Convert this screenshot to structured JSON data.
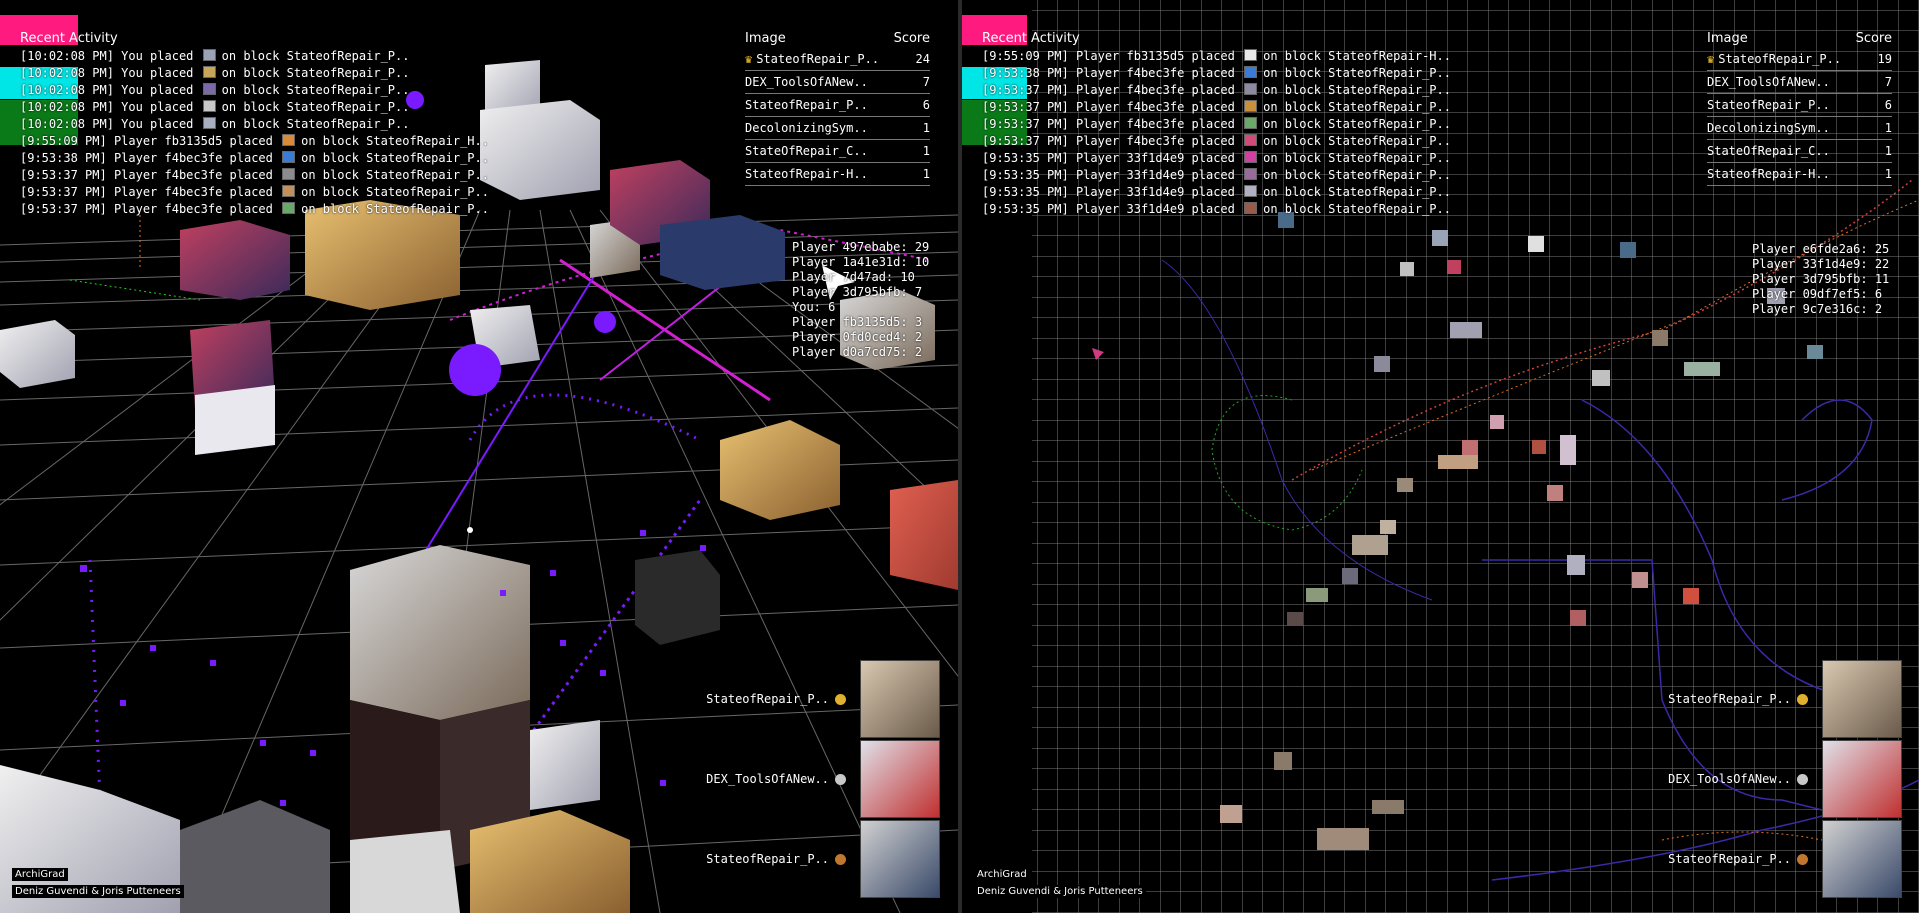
{
  "left": {
    "activity_title": "Recent Activity",
    "activity": [
      {
        "time": "[10:02:08 PM]",
        "text": "You placed",
        "block": "on block StateofRepair_P..",
        "color": "#9aa3b5"
      },
      {
        "time": "[10:02:08 PM]",
        "text": "You placed",
        "block": "on block StateofRepair_P..",
        "color": "#c7a65b"
      },
      {
        "time": "[10:02:08 PM]",
        "text": "You placed",
        "block": "on block StateofRepair_P..",
        "color": "#7a6aa8"
      },
      {
        "time": "[10:02:08 PM]",
        "text": "You placed",
        "block": "on block StateofRepair_P..",
        "color": "#c9c9c9"
      },
      {
        "time": "[10:02:08 PM]",
        "text": "You placed",
        "block": "on block StateofRepair_P..",
        "color": "#a8b0c0"
      },
      {
        "time": "[9:55:09 PM]",
        "text": "Player fb3135d5 placed",
        "block": "on block StateofRepair_H..",
        "color": "#d88a3a"
      },
      {
        "time": "[9:53:38 PM]",
        "text": "Player f4bec3fe placed",
        "block": "on block StateofRepair_P..",
        "color": "#3a7bd5"
      },
      {
        "time": "[9:53:37 PM]",
        "text": "Player f4bec3fe placed",
        "block": "on block StateofRepair_P..",
        "color": "#8c8c8c"
      },
      {
        "time": "[9:53:37 PM]",
        "text": "Player f4bec3fe placed",
        "block": "on block StateofRepair_P..",
        "color": "#c2905a"
      },
      {
        "time": "[9:53:37 PM]",
        "text": "Player f4bec3fe placed",
        "block": "on block StateofRepair_P..",
        "color": "#6aa86a"
      }
    ],
    "board_head": {
      "image": "Image",
      "score": "Score"
    },
    "board": [
      {
        "name": "StateofRepair_P..",
        "score": "24",
        "crown": "♛"
      },
      {
        "name": "DEX_ToolsOfANew..",
        "score": "7",
        "crown": ""
      },
      {
        "name": "StateofRepair_P..",
        "score": "6",
        "crown": ""
      },
      {
        "name": "DecolonizingSym..",
        "score": "1",
        "crown": ""
      },
      {
        "name": "StateOfRepair_C..",
        "score": "1",
        "crown": ""
      },
      {
        "name": "StateofRepair-H..",
        "score": "1",
        "crown": ""
      }
    ],
    "players": [
      "Player 497ebabe: 29",
      "Player 1a41e31d: 10",
      "Player 7d47ad: 10",
      "Player 3d795bfb: 7",
      "You: 6",
      "Player fb3135d5: 3",
      "Player 0fd0ced4: 2",
      "Player d0a7cd75: 2"
    ],
    "gallery": [
      {
        "label": "StateofRepair_P..",
        "medal": "#e0b030"
      },
      {
        "label": "DEX_ToolsOfANew..",
        "medal": "#c8c8c8"
      },
      {
        "label": "StateofRepair_P..",
        "medal": "#c07830"
      }
    ],
    "credit_1": "ArchiGrad",
    "credit_2": "Deniz Guvendi & Joris Putteneers"
  },
  "right": {
    "activity_title": "Recent Activity",
    "activity": [
      {
        "time": "[9:55:09 PM]",
        "text": "Player fb3135d5 placed",
        "block": "on block StateofRepair-H..",
        "color": "#e8e8e8"
      },
      {
        "time": "[9:53:38 PM]",
        "text": "Player f4bec3fe placed",
        "block": "on block StateofRepair_P..",
        "color": "#3a7bd5"
      },
      {
        "time": "[9:53:37 PM]",
        "text": "Player f4bec3fe placed",
        "block": "on block StateofRepair_P..",
        "color": "#8a8aa0"
      },
      {
        "time": "[9:53:37 PM]",
        "text": "Player f4bec3fe placed",
        "block": "on block StateofRepair_P..",
        "color": "#c8903a"
      },
      {
        "time": "[9:53:37 PM]",
        "text": "Player f4bec3fe placed",
        "block": "on block StateofRepair_P..",
        "color": "#6aa86a"
      },
      {
        "time": "[9:53:37 PM]",
        "text": "Player f4bec3fe placed",
        "block": "on block StateofRepair_P..",
        "color": "#d04a7a"
      },
      {
        "time": "[9:53:35 PM]",
        "text": "Player 33f1d4e9 placed",
        "block": "on block StateofRepair_P..",
        "color": "#d040a0"
      },
      {
        "time": "[9:53:35 PM]",
        "text": "Player 33f1d4e9 placed",
        "block": "on block StateofRepair_P..",
        "color": "#9a6a9a"
      },
      {
        "time": "[9:53:35 PM]",
        "text": "Player 33f1d4e9 placed",
        "block": "on block StateofRepair_P..",
        "color": "#b0b0c0"
      },
      {
        "time": "[9:53:35 PM]",
        "text": "Player 33f1d4e9 placed",
        "block": "on block StateofRepair_P..",
        "color": "#9a5a4a"
      }
    ],
    "board_head": {
      "image": "Image",
      "score": "Score"
    },
    "board": [
      {
        "name": "StateofRepair_P..",
        "score": "19",
        "crown": "♛"
      },
      {
        "name": "DEX_ToolsOfANew..",
        "score": "7",
        "crown": ""
      },
      {
        "name": "StateofRepair_P..",
        "score": "6",
        "crown": ""
      },
      {
        "name": "DecolonizingSym..",
        "score": "1",
        "crown": ""
      },
      {
        "name": "StateOfRepair_C..",
        "score": "1",
        "crown": ""
      },
      {
        "name": "StateofRepair-H..",
        "score": "1",
        "crown": ""
      }
    ],
    "players": [
      "Player e6fde2a6: 25",
      "Player 33f1d4e9: 22",
      "Player 3d795bfb: 11",
      "Player 09df7ef5: 6",
      "Player 9c7e316c: 2"
    ],
    "gallery": [
      {
        "label": "StateofRepair_P..",
        "medal": "#e0b030"
      },
      {
        "label": "DEX_ToolsOfANew..",
        "medal": "#c8c8c8"
      },
      {
        "label": "StateofRepair_P..",
        "medal": "#c07830"
      }
    ],
    "credit_1": "ArchiGrad",
    "credit_2": "Deniz Guvendi & Joris Putteneers"
  },
  "colors": {
    "accent_magenta": "#ff1a80",
    "accent_cyan": "#00e5e5",
    "accent_green": "#0a7a18",
    "player_purple": "#7a1aff",
    "trail_magenta": "#d020d0"
  }
}
